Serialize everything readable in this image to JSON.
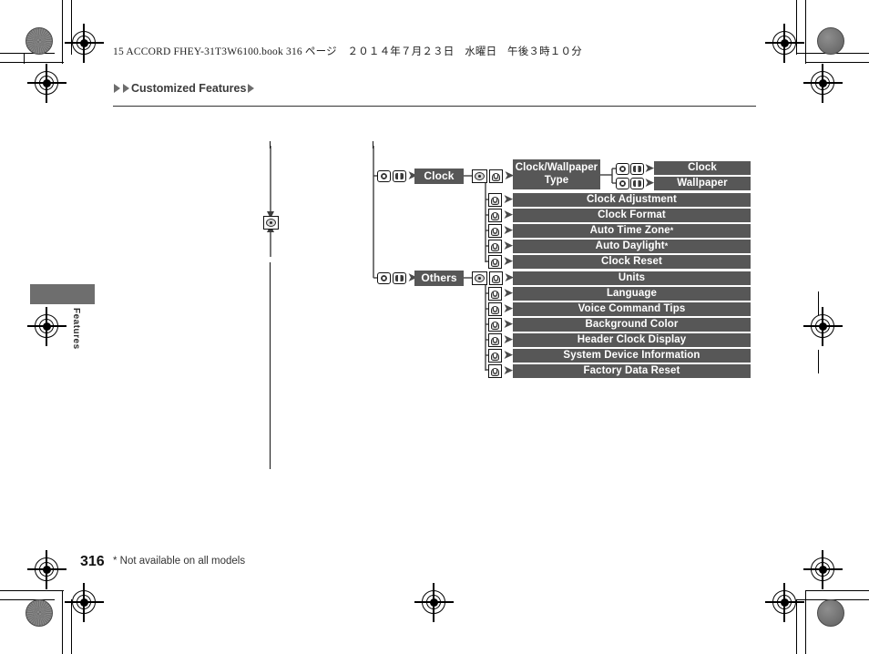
{
  "page": {
    "file_header": "15 ACCORD FHEY-31T3W6100.book   316 ページ　２０１４年７月２３日　水曜日　午後３時１０分",
    "breadcrumb": "Customized Features",
    "side_tab_label": "Features",
    "page_number": "316",
    "footnote": "* Not available on all models"
  },
  "diagram": {
    "groups": [
      {
        "name": "Clock",
        "label": "Clock",
        "items": [
          {
            "label": "Clock/Wallpaper Type",
            "children": [
              "Clock",
              "Wallpaper"
            ]
          },
          {
            "label": "Clock Adjustment",
            "children": []
          },
          {
            "label": "Clock Format",
            "children": []
          },
          {
            "label": "Auto Time Zone*",
            "children": []
          },
          {
            "label": "Auto Daylight*",
            "children": []
          },
          {
            "label": "Clock Reset",
            "children": []
          }
        ]
      },
      {
        "name": "Others",
        "label": "Others",
        "items": [
          {
            "label": "Units",
            "children": []
          },
          {
            "label": "Language",
            "children": []
          },
          {
            "label": "Voice Command Tips",
            "children": []
          },
          {
            "label": "Background Color",
            "children": []
          },
          {
            "label": "Header Clock Display",
            "children": []
          },
          {
            "label": "System Device Information",
            "children": []
          },
          {
            "label": "Factory Data Reset",
            "children": []
          }
        ]
      }
    ],
    "sub_labels": {
      "clock": "Clock",
      "wallpaper": "Wallpaper"
    },
    "icons": {
      "dial": "dial-knob-icon",
      "press": "press-select-icon",
      "button_pair": "button-pair-icon"
    },
    "colors": {
      "bar": "#575757",
      "tab": "#6e6e6e",
      "text": "#ffffff"
    }
  }
}
